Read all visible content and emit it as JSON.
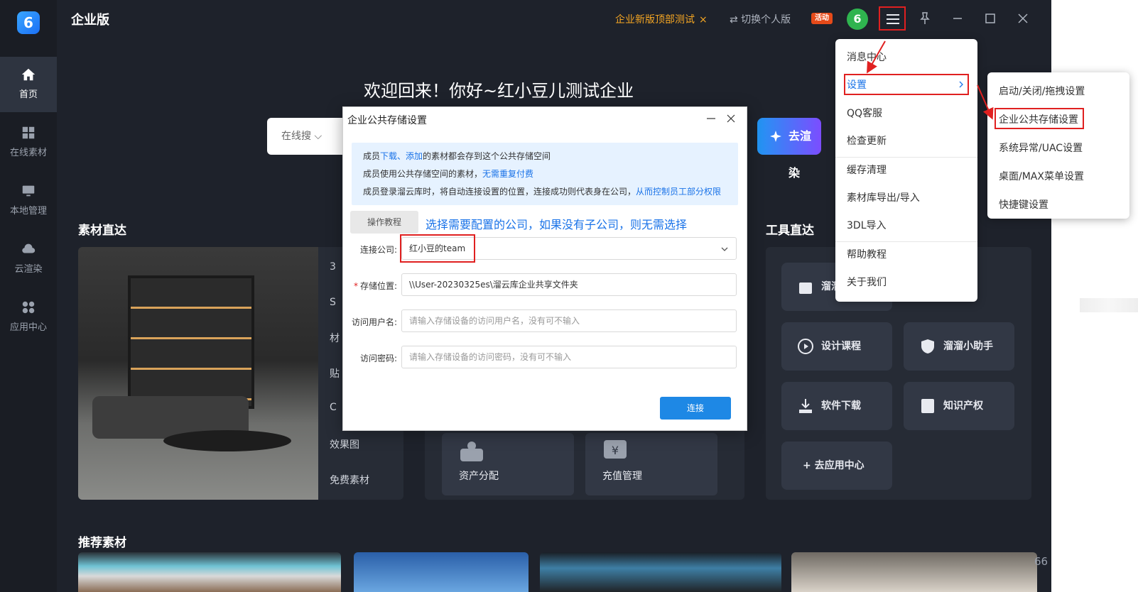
{
  "app": {
    "title": "企业版",
    "logo_char": "6",
    "promo": "企业新版顶部测试",
    "promo_close": "×",
    "switch_label": "⇄ 切换个人版",
    "event_badge": "活动",
    "avatar_char": "6"
  },
  "sidebar": {
    "items": [
      {
        "label": "首页",
        "icon": "home-icon"
      },
      {
        "label": "在线素材",
        "icon": "grid-icon"
      },
      {
        "label": "本地管理",
        "icon": "monitor-icon"
      },
      {
        "label": "云渲染",
        "icon": "cloud-icon"
      },
      {
        "label": "应用中心",
        "icon": "apps-icon"
      }
    ]
  },
  "main": {
    "welcome": "欢迎回来！你好~红小豆儿测试企业",
    "search_scope": "在线搜",
    "render_button": "去渲染",
    "materials_title": "素材直达",
    "tools_title": "工具直达",
    "recommend_title": "推荐素材",
    "categories": [
      "3",
      "S",
      "材",
      "贴",
      "C",
      "效果图",
      "免费素材"
    ],
    "mid_cards": [
      "资产分配",
      "充值管理"
    ],
    "tools": [
      "溜溜",
      "设计课程",
      "溜溜小助手",
      "软件下载",
      "知识产权",
      "+ 去应用中心"
    ],
    "page_number": "66"
  },
  "dialog": {
    "title": "企业公共存储设置",
    "info_lines": [
      {
        "prefix": "成员",
        "link": "下载、添加",
        "suffix": "的素材都会存到这个公共存储空间"
      },
      {
        "prefix": "成员使用公共存储空间的素材，",
        "link": "无需重复付费",
        "suffix": ""
      },
      {
        "prefix": "成员登录溜云库时，将自动连接设置的位置，连接成功则代表身在公司，",
        "link": "从而控制员工部分权限",
        "suffix": ""
      }
    ],
    "tutorial_button": "操作教程",
    "hint": "选择需要配置的公司，如果没有子公司，则无需选择",
    "company_label": "连接公司:",
    "company_value": "红小豆的team",
    "storage_label": "存储位置:",
    "storage_value": "\\\\User-20230325es\\溜云库企业共享文件夹",
    "username_label": "访问用户名:",
    "username_placeholder": "请输入存储设备的访问用户名，没有可不输入",
    "password_label": "访问密码:",
    "password_placeholder": "请输入存储设备的访问密码，没有可不输入",
    "connect_button": "连接"
  },
  "menu": {
    "items": [
      "消息中心",
      "设置",
      "QQ客服",
      "检查更新",
      "缓存清理",
      "素材库导出/导入",
      "3DL导入",
      "帮助教程",
      "关于我们"
    ]
  },
  "submenu": {
    "items": [
      "启动/关闭/拖拽设置",
      "企业公共存储设置",
      "系统异常/UAC设置",
      "桌面/MAX菜单设置",
      "快捷键设置"
    ]
  },
  "colors": {
    "app_bg": "#1e222b",
    "accent": "#1e88e5",
    "highlight": "#e02020",
    "promo": "#f5a623"
  }
}
